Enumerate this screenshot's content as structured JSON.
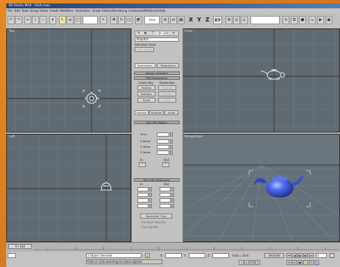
{
  "window": {
    "title": "3D Studio MAX - Utah.max"
  },
  "menubar": {
    "items": [
      "File",
      "Edit",
      "Tools",
      "Group",
      "Views",
      "Create",
      "Modifiers",
      "Animation",
      "Graph Editors",
      "Rendering",
      "Customize",
      "MAXScript",
      "Help"
    ]
  },
  "toolbar": {
    "axis_x": "X",
    "axis_y": "Y",
    "axis_z": "Z",
    "axis_xy": "XY",
    "view_dropdown": "View",
    "selection_set": ""
  },
  "viewports": {
    "top": "Top",
    "front": "Front",
    "left": "Left",
    "perspective": "Perspective"
  },
  "command_panel": {
    "object_name": "Teapot01",
    "selection_level_label": "Selection Level:",
    "sub_object": "Sub-Object",
    "parameters_btn": "Parameters",
    "trajectories_btn": "Trajectories",
    "assign_controller": "Assign Controller",
    "pro_parameters": "PRS Parameters",
    "create_key": "Create Key",
    "delete_key": "Delete Key",
    "position": "Position",
    "rotation": "Rotation",
    "scale": "Scale",
    "tab_position": "Position",
    "tab_rotation": "Rotation",
    "tab_scale": "Scale",
    "key_info_basic": "Key Info (Basic)",
    "time_label": "Time:",
    "xvalue_label": "X Value:",
    "yvalue_label": "Y Value:",
    "zvalue_label": "Z Value:",
    "in_label": "In:",
    "out_label": "Out:",
    "key_info_advanced": "Key Info (Advanced)",
    "in_col": "In",
    "out_col": "Out",
    "normalize_time": "Normalize Time",
    "constant_velocity": "Constant Velocity",
    "free_handle": "Free Handle"
  },
  "timeline": {
    "slider": "0 / 100"
  },
  "statusbar": {
    "selection": "1 Object Selected",
    "prompt": "Click or click-and-drag to select objects",
    "x_label": "X:",
    "y_label": "Y:",
    "z_label": "Z:",
    "grid": "Grid = 10.0",
    "auto_key": "Animate",
    "frame": "0"
  },
  "colors": {
    "viewport_bg": "#5f6a73",
    "grid_line": "#7a858d",
    "teapot_shaded": "#3a5ad8",
    "accent_orange": "#d8781c"
  }
}
